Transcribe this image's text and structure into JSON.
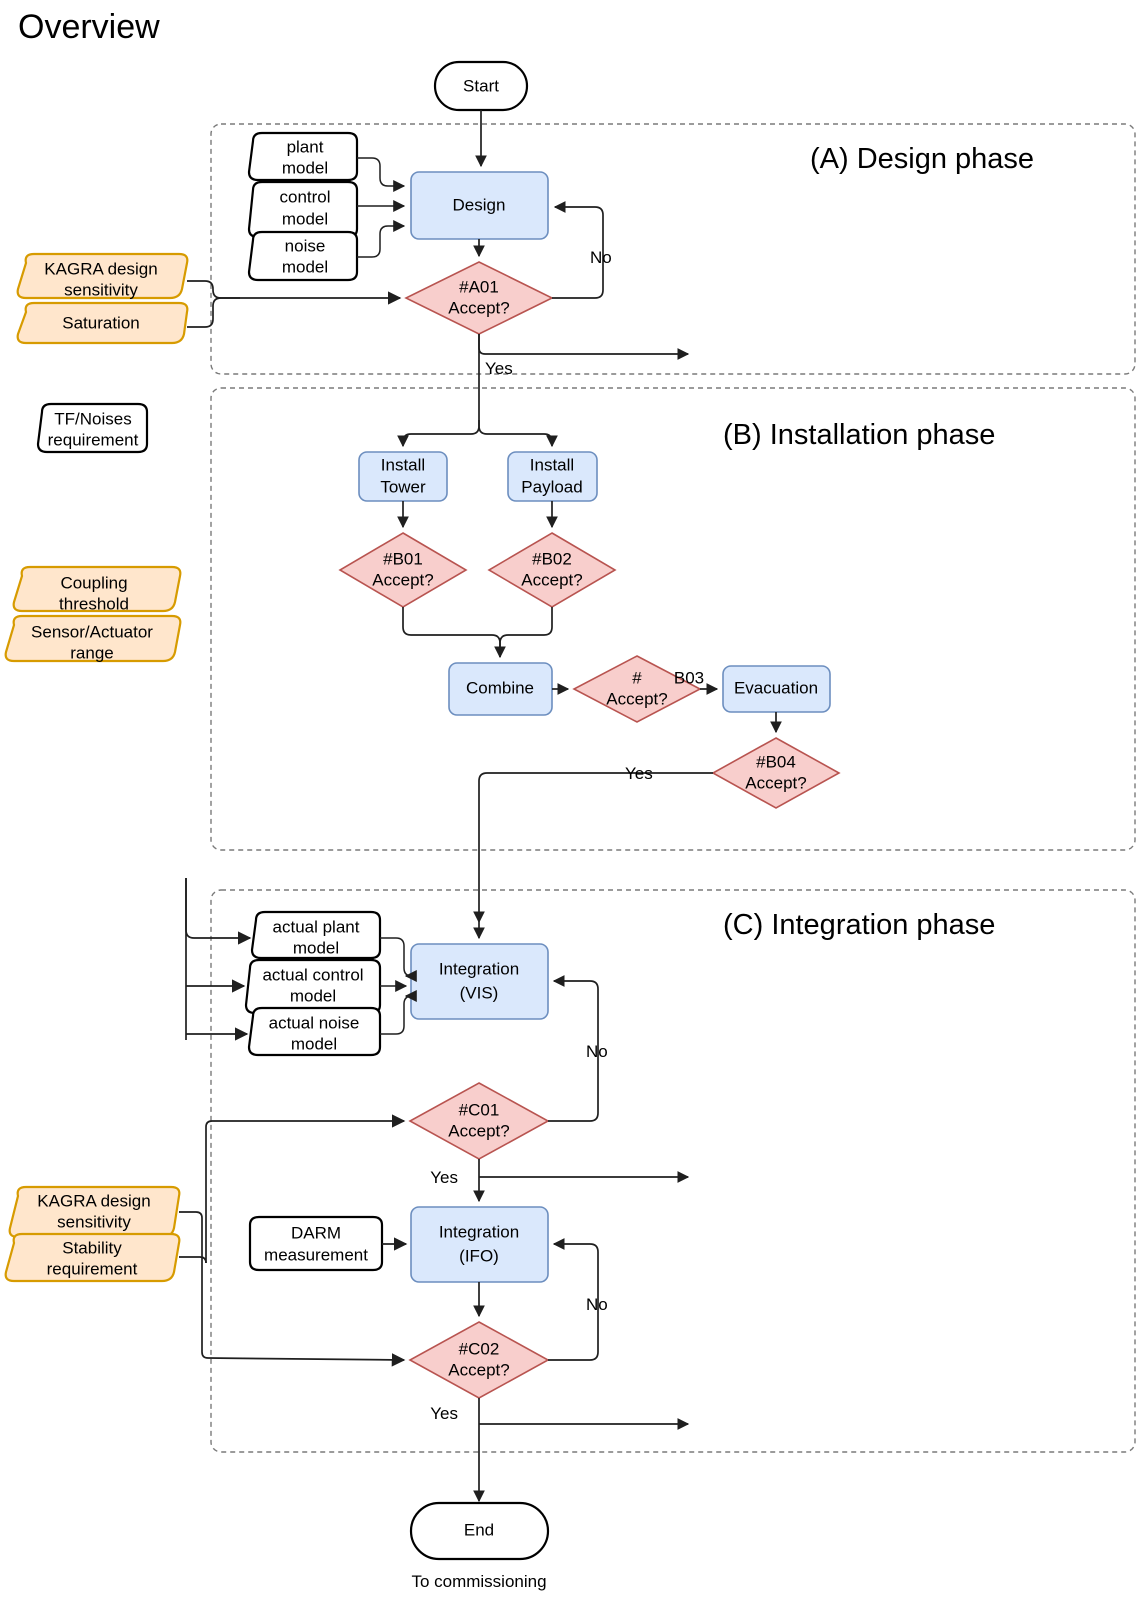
{
  "page": {
    "title": "Overview",
    "footer_caption": "To commissioning"
  },
  "colors": {
    "process_fill": "#dae8fc",
    "process_stroke": "#6c8ebf",
    "decision_fill": "#f8cecc",
    "decision_stroke": "#b85450",
    "data_fill": "#ffe6cc",
    "data_stroke": "#d79b00",
    "doc_fill": "#ffffff",
    "doc_stroke": "#000000",
    "phase_border": "#7a7a7a"
  },
  "phases": [
    {
      "id": "A",
      "title": "(A) Design phase"
    },
    {
      "id": "B",
      "title": "(B) Installation phase"
    },
    {
      "id": "C",
      "title": "(C) Integration phase"
    }
  ],
  "terminals": {
    "start": "Start",
    "end": "End"
  },
  "phase_a": {
    "inputs": [
      {
        "line1": "plant",
        "line2": "model"
      },
      {
        "line1": "control",
        "line2": "model"
      },
      {
        "line1": "noise",
        "line2": "model"
      }
    ],
    "criteria": [
      {
        "line1": "KAGRA design",
        "line2": "sensitivity"
      },
      {
        "line1": "Saturation",
        "line2": ""
      }
    ],
    "process": {
      "line1": "Design",
      "line2": ""
    },
    "decision": {
      "line1": "#A01",
      "line2": "Accept?"
    },
    "edge_no": "No",
    "edge_yes": "Yes"
  },
  "phase_b": {
    "criteria": [
      {
        "line1": "TF/Noises",
        "line2": "requirement",
        "kind": "doc"
      },
      {
        "line1": "Coupling",
        "line2": "threshold",
        "kind": "data"
      },
      {
        "line1": "Sensor/Actuator",
        "line2": "range",
        "kind": "data"
      }
    ],
    "processes": [
      {
        "line1": "Install",
        "line2": "Tower"
      },
      {
        "line1": "Install",
        "line2": "Payload"
      },
      {
        "line1": "Combine",
        "line2": ""
      },
      {
        "line1": "Evacuation",
        "line2": ""
      }
    ],
    "decisions": [
      {
        "line1": "#B01",
        "line2": "Accept?"
      },
      {
        "line1": "#B02",
        "line2": "Accept?"
      },
      {
        "line1": "#B03",
        "line2": "Accept?"
      },
      {
        "line1": "#B04",
        "line2": "Accept?"
      }
    ],
    "edge_yes": "Yes"
  },
  "phase_c": {
    "inputs": [
      {
        "line1": "actual plant",
        "line2": "model"
      },
      {
        "line1": "actual control",
        "line2": "model"
      },
      {
        "line1": "actual noise",
        "line2": "model"
      }
    ],
    "criteria": [
      {
        "line1": "KAGRA design",
        "line2": "sensitivity"
      },
      {
        "line1": "Stability",
        "line2": "requirement"
      }
    ],
    "darm": {
      "line1": "DARM",
      "line2": "measurement"
    },
    "processes": [
      {
        "line1": "Integration",
        "line2": "(VIS)"
      },
      {
        "line1": "Integration",
        "line2": "(IFO)"
      }
    ],
    "decisions": [
      {
        "line1": "#C01",
        "line2": "Accept?"
      },
      {
        "line1": "#C02",
        "line2": "Accept?"
      }
    ],
    "edge_no": "No",
    "edge_yes": "Yes"
  }
}
